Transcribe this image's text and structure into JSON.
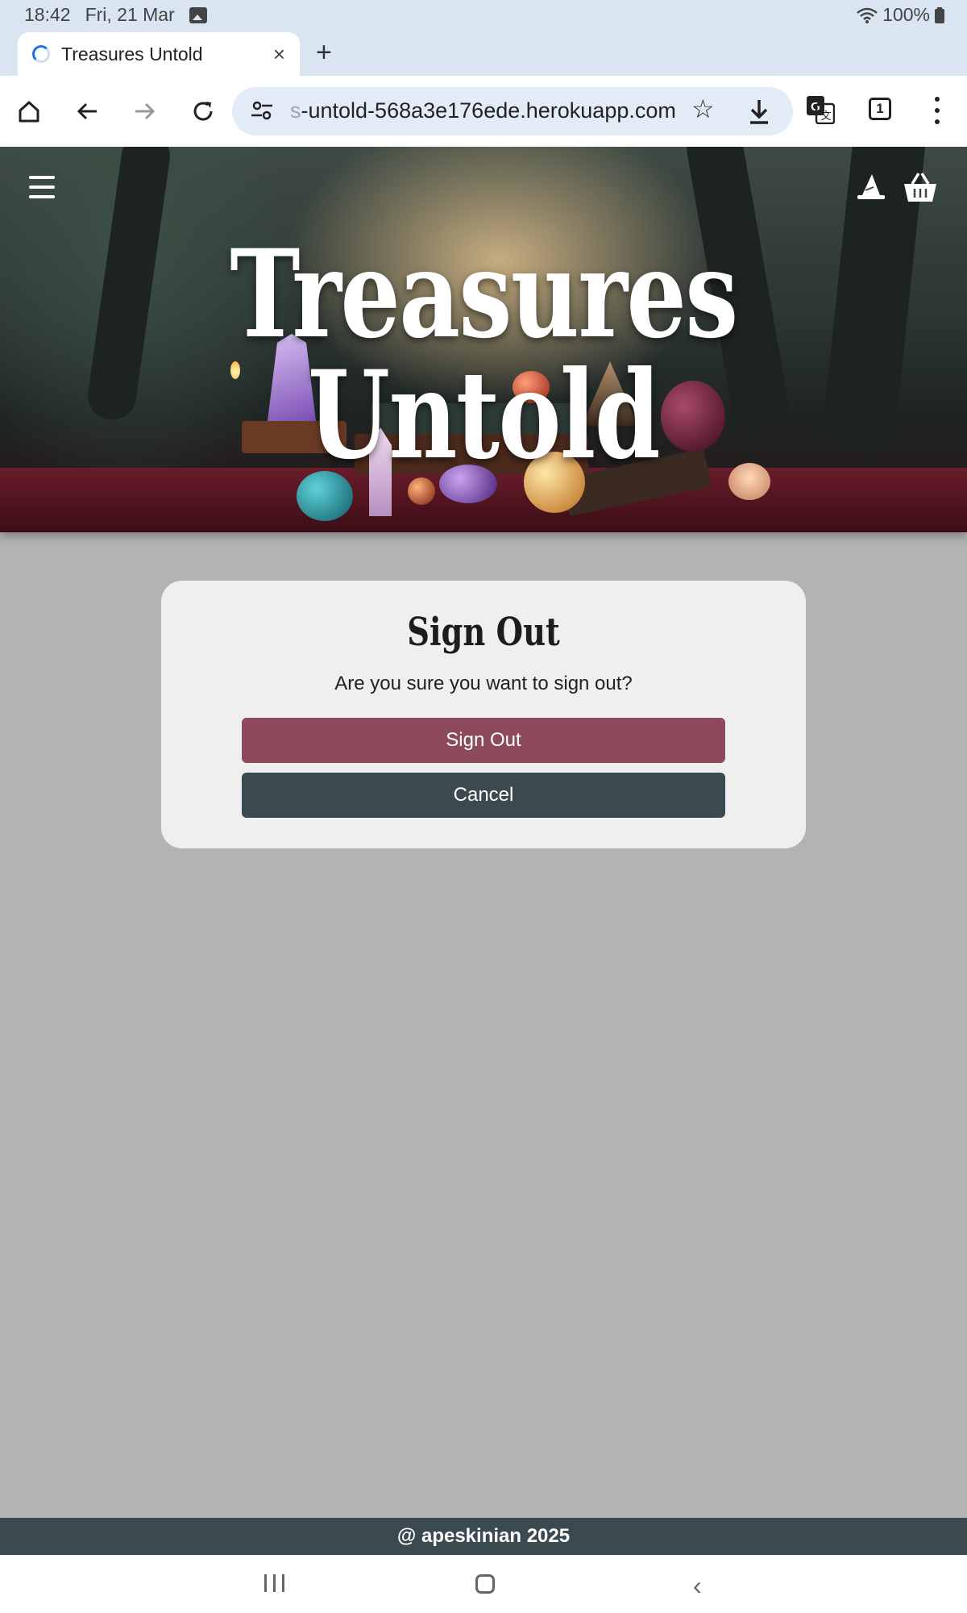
{
  "status_bar": {
    "time": "18:42",
    "date": "Fri, 21 Mar",
    "battery": "100%",
    "icons": [
      "image-notification-icon",
      "wifi-icon",
      "battery-icon"
    ]
  },
  "browser": {
    "tab_title": "Treasures Untold",
    "tab_close": "×",
    "new_tab": "+",
    "url_prefix_faded": "s",
    "url": "-untold-568a3e176ede.herokuapp.com",
    "tab_count": "1",
    "toolbar_icons": [
      "home-icon",
      "back-icon",
      "forward-icon",
      "reload-icon",
      "site-settings-icon",
      "bookmark-star-icon",
      "download-icon",
      "translate-icon",
      "tab-switcher-icon",
      "more-menu-icon"
    ]
  },
  "header": {
    "site_title": "Treasures Untold",
    "icons": [
      "hamburger-menu-icon",
      "wizard-hat-icon",
      "basket-icon"
    ]
  },
  "signout_card": {
    "title": "Sign Out",
    "message": "Are you sure you want to sign out?",
    "confirm_label": "Sign Out",
    "cancel_label": "Cancel"
  },
  "footer": {
    "text": "@ apeskinian 2025"
  },
  "colors": {
    "confirm_button": "#8c4a5a",
    "cancel_button": "#3a4a4f",
    "footer_bg": "#3a4a4f",
    "page_bg": "#b3b3b3",
    "chrome_bg": "#d9e6f2"
  }
}
